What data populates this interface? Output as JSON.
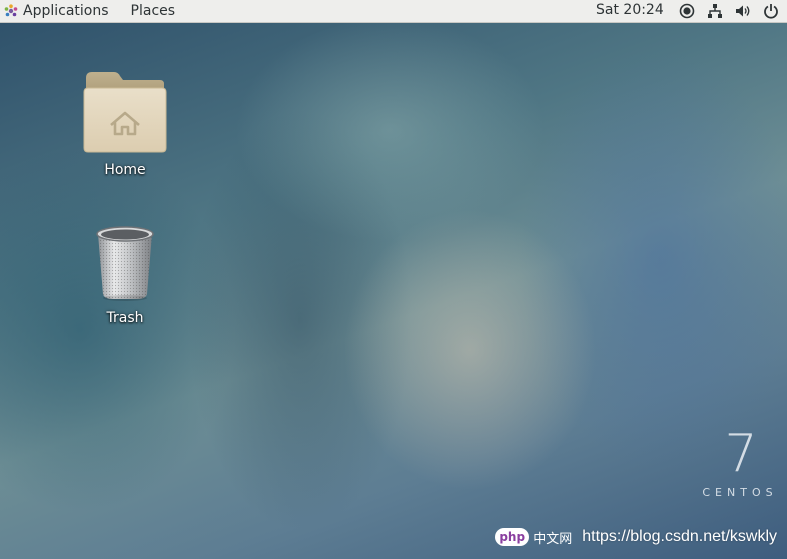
{
  "topbar": {
    "applications_label": "Applications",
    "places_label": "Places",
    "clock": "Sat 20:24",
    "tray_icons": [
      "accessibility-icon",
      "network-icon",
      "volume-icon",
      "power-icon"
    ]
  },
  "desktop": {
    "icons": [
      {
        "label": "Home",
        "icon": "home-folder-icon"
      },
      {
        "label": "Trash",
        "icon": "trash-icon"
      }
    ]
  },
  "branding": {
    "version": "7",
    "name": "CENTOS"
  },
  "watermark": {
    "logo_text": "php",
    "cn_text": "中文网",
    "url": "https://blog.csdn.net/kswkly"
  },
  "colors": {
    "topbar_bg": "#eeeeec",
    "folder": "#d8cbb0",
    "label_text": "#ffffff"
  }
}
